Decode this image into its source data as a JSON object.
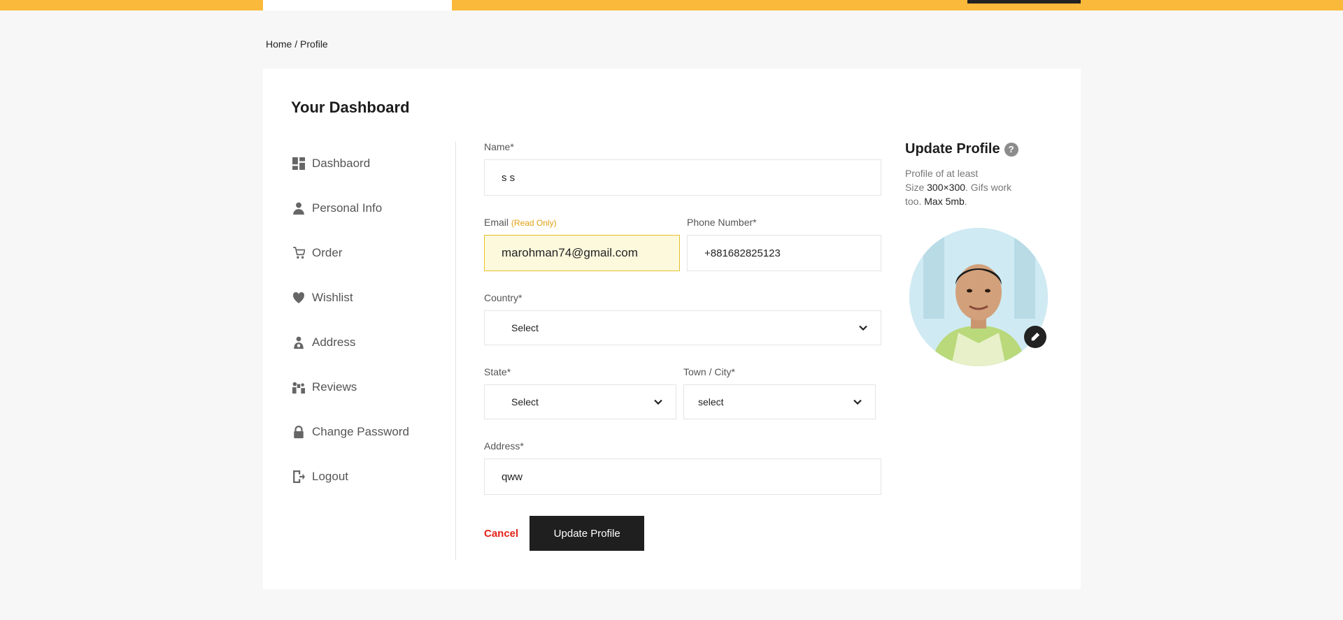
{
  "breadcrumb": {
    "home": "Home",
    "separator": "/",
    "current": "Profile"
  },
  "dashboard_title": "Your Dashboard",
  "sidebar": {
    "items": [
      {
        "label": "Dashbaord",
        "icon": "dashboard-icon"
      },
      {
        "label": "Personal Info",
        "icon": "person-icon"
      },
      {
        "label": "Order",
        "icon": "cart-icon"
      },
      {
        "label": "Wishlist",
        "icon": "heart-icon"
      },
      {
        "label": "Address",
        "icon": "location-person-icon"
      },
      {
        "label": "Reviews",
        "icon": "reviews-icon"
      },
      {
        "label": "Change Password",
        "icon": "lock-icon"
      },
      {
        "label": "Logout",
        "icon": "logout-icon"
      }
    ]
  },
  "form": {
    "name_label": "Name*",
    "name_value": "s s",
    "email_label": "Email",
    "email_readonly": "(Read Only)",
    "email_value": "marohman74@gmail.com",
    "phone_label": "Phone Number*",
    "phone_value": "+881682825123",
    "country_label": "Country*",
    "country_value": "Select",
    "state_label": "State*",
    "state_value": "Select",
    "city_label": "Town / City*",
    "city_value": "select",
    "address_label": "Address*",
    "address_value": "qww",
    "cancel_label": "Cancel",
    "update_label": "Update Profile"
  },
  "profile_panel": {
    "title": "Update Profile",
    "help": "?",
    "desc_1": "Profile of at least",
    "desc_2_prefix": "Size ",
    "desc_2_size": "300×300",
    "desc_2_suffix": ". Gifs work",
    "desc_3_prefix": "too. ",
    "desc_3_max": "Max 5mb",
    "desc_3_suffix": "."
  },
  "colors": {
    "accent": "#fbb93b",
    "danger": "#e2231a",
    "dark": "#1f1f1f"
  }
}
